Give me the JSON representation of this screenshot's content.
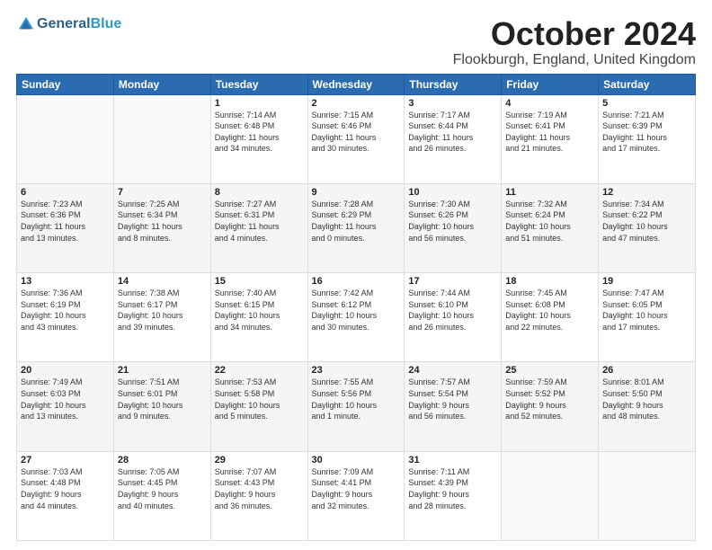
{
  "header": {
    "logo_general": "General",
    "logo_blue": "Blue",
    "month_title": "October 2024",
    "location": "Flookburgh, England, United Kingdom"
  },
  "days_of_week": [
    "Sunday",
    "Monday",
    "Tuesday",
    "Wednesday",
    "Thursday",
    "Friday",
    "Saturday"
  ],
  "weeks": [
    [
      {
        "day": "",
        "info": ""
      },
      {
        "day": "",
        "info": ""
      },
      {
        "day": "1",
        "info": "Sunrise: 7:14 AM\nSunset: 6:48 PM\nDaylight: 11 hours\nand 34 minutes."
      },
      {
        "day": "2",
        "info": "Sunrise: 7:15 AM\nSunset: 6:46 PM\nDaylight: 11 hours\nand 30 minutes."
      },
      {
        "day": "3",
        "info": "Sunrise: 7:17 AM\nSunset: 6:44 PM\nDaylight: 11 hours\nand 26 minutes."
      },
      {
        "day": "4",
        "info": "Sunrise: 7:19 AM\nSunset: 6:41 PM\nDaylight: 11 hours\nand 21 minutes."
      },
      {
        "day": "5",
        "info": "Sunrise: 7:21 AM\nSunset: 6:39 PM\nDaylight: 11 hours\nand 17 minutes."
      }
    ],
    [
      {
        "day": "6",
        "info": "Sunrise: 7:23 AM\nSunset: 6:36 PM\nDaylight: 11 hours\nand 13 minutes."
      },
      {
        "day": "7",
        "info": "Sunrise: 7:25 AM\nSunset: 6:34 PM\nDaylight: 11 hours\nand 8 minutes."
      },
      {
        "day": "8",
        "info": "Sunrise: 7:27 AM\nSunset: 6:31 PM\nDaylight: 11 hours\nand 4 minutes."
      },
      {
        "day": "9",
        "info": "Sunrise: 7:28 AM\nSunset: 6:29 PM\nDaylight: 11 hours\nand 0 minutes."
      },
      {
        "day": "10",
        "info": "Sunrise: 7:30 AM\nSunset: 6:26 PM\nDaylight: 10 hours\nand 56 minutes."
      },
      {
        "day": "11",
        "info": "Sunrise: 7:32 AM\nSunset: 6:24 PM\nDaylight: 10 hours\nand 51 minutes."
      },
      {
        "day": "12",
        "info": "Sunrise: 7:34 AM\nSunset: 6:22 PM\nDaylight: 10 hours\nand 47 minutes."
      }
    ],
    [
      {
        "day": "13",
        "info": "Sunrise: 7:36 AM\nSunset: 6:19 PM\nDaylight: 10 hours\nand 43 minutes."
      },
      {
        "day": "14",
        "info": "Sunrise: 7:38 AM\nSunset: 6:17 PM\nDaylight: 10 hours\nand 39 minutes."
      },
      {
        "day": "15",
        "info": "Sunrise: 7:40 AM\nSunset: 6:15 PM\nDaylight: 10 hours\nand 34 minutes."
      },
      {
        "day": "16",
        "info": "Sunrise: 7:42 AM\nSunset: 6:12 PM\nDaylight: 10 hours\nand 30 minutes."
      },
      {
        "day": "17",
        "info": "Sunrise: 7:44 AM\nSunset: 6:10 PM\nDaylight: 10 hours\nand 26 minutes."
      },
      {
        "day": "18",
        "info": "Sunrise: 7:45 AM\nSunset: 6:08 PM\nDaylight: 10 hours\nand 22 minutes."
      },
      {
        "day": "19",
        "info": "Sunrise: 7:47 AM\nSunset: 6:05 PM\nDaylight: 10 hours\nand 17 minutes."
      }
    ],
    [
      {
        "day": "20",
        "info": "Sunrise: 7:49 AM\nSunset: 6:03 PM\nDaylight: 10 hours\nand 13 minutes."
      },
      {
        "day": "21",
        "info": "Sunrise: 7:51 AM\nSunset: 6:01 PM\nDaylight: 10 hours\nand 9 minutes."
      },
      {
        "day": "22",
        "info": "Sunrise: 7:53 AM\nSunset: 5:58 PM\nDaylight: 10 hours\nand 5 minutes."
      },
      {
        "day": "23",
        "info": "Sunrise: 7:55 AM\nSunset: 5:56 PM\nDaylight: 10 hours\nand 1 minute."
      },
      {
        "day": "24",
        "info": "Sunrise: 7:57 AM\nSunset: 5:54 PM\nDaylight: 9 hours\nand 56 minutes."
      },
      {
        "day": "25",
        "info": "Sunrise: 7:59 AM\nSunset: 5:52 PM\nDaylight: 9 hours\nand 52 minutes."
      },
      {
        "day": "26",
        "info": "Sunrise: 8:01 AM\nSunset: 5:50 PM\nDaylight: 9 hours\nand 48 minutes."
      }
    ],
    [
      {
        "day": "27",
        "info": "Sunrise: 7:03 AM\nSunset: 4:48 PM\nDaylight: 9 hours\nand 44 minutes."
      },
      {
        "day": "28",
        "info": "Sunrise: 7:05 AM\nSunset: 4:45 PM\nDaylight: 9 hours\nand 40 minutes."
      },
      {
        "day": "29",
        "info": "Sunrise: 7:07 AM\nSunset: 4:43 PM\nDaylight: 9 hours\nand 36 minutes."
      },
      {
        "day": "30",
        "info": "Sunrise: 7:09 AM\nSunset: 4:41 PM\nDaylight: 9 hours\nand 32 minutes."
      },
      {
        "day": "31",
        "info": "Sunrise: 7:11 AM\nSunset: 4:39 PM\nDaylight: 9 hours\nand 28 minutes."
      },
      {
        "day": "",
        "info": ""
      },
      {
        "day": "",
        "info": ""
      }
    ]
  ]
}
